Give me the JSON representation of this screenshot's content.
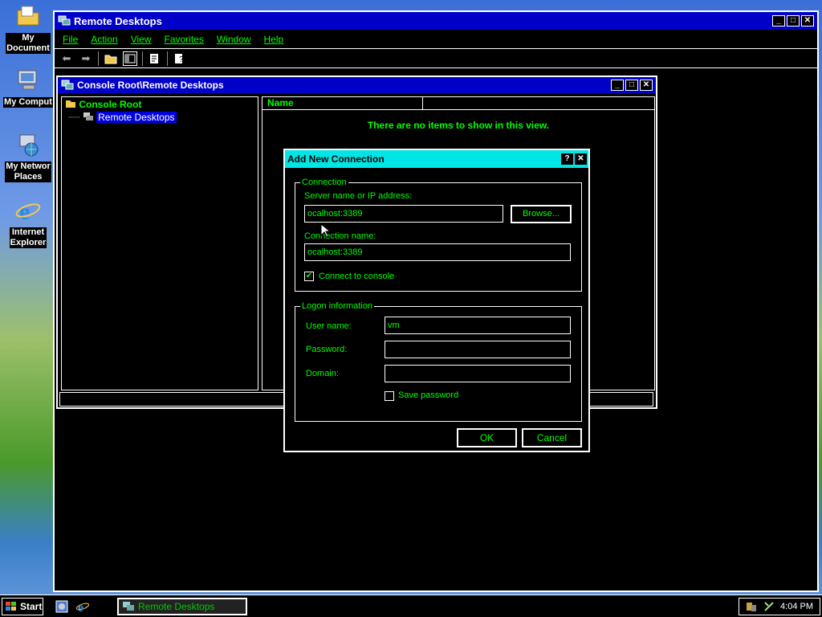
{
  "desktop": {
    "icons": [
      {
        "label": "My Documents",
        "display": "My\nDocument",
        "icon": "folder-documents-icon"
      },
      {
        "label": "My Computer",
        "display": "My Comput",
        "icon": "my-computer-icon"
      },
      {
        "label": "My Network Places",
        "display": "My Networ\nPlaces",
        "icon": "network-places-icon"
      },
      {
        "label": "Internet Explorer",
        "display": "Internet\nExplorer",
        "icon": "internet-explorer-icon"
      }
    ]
  },
  "main_window": {
    "title": "Remote Desktops",
    "menu": [
      "File",
      "Action",
      "View",
      "Favorites",
      "Window",
      "Help"
    ]
  },
  "mdi_window": {
    "title": "Console Root\\Remote Desktops",
    "tree": {
      "root": "Console Root",
      "child": "Remote Desktops"
    },
    "list": {
      "column_name": "Name",
      "empty_message": "There are no items to show in this view."
    }
  },
  "dialog": {
    "title": "Add New Connection",
    "connection_group": "Connection",
    "server_label": "Server name or IP address:",
    "server_value": "ocalhost:3389",
    "browse_label": "Browse...",
    "connection_name_label": "Connection name:",
    "connection_name_value": "ocalhost:3389",
    "connect_console_label": "Connect to console",
    "connect_console_checked": true,
    "logon_group": "Logon information",
    "username_label": "User name:",
    "username_value": "vm",
    "password_label": "Password:",
    "password_value": "",
    "domain_label": "Domain:",
    "domain_value": "",
    "save_password_label": "Save password",
    "save_password_checked": false,
    "ok_label": "OK",
    "cancel_label": "Cancel"
  },
  "taskbar": {
    "start_label": "Start",
    "task_label": "Remote Desktops",
    "clock": "4:04 PM"
  },
  "colors": {
    "text": "#00ff00",
    "title_active": "#0000c8",
    "dialog_title": "#00e5e5",
    "background": "#000000"
  }
}
